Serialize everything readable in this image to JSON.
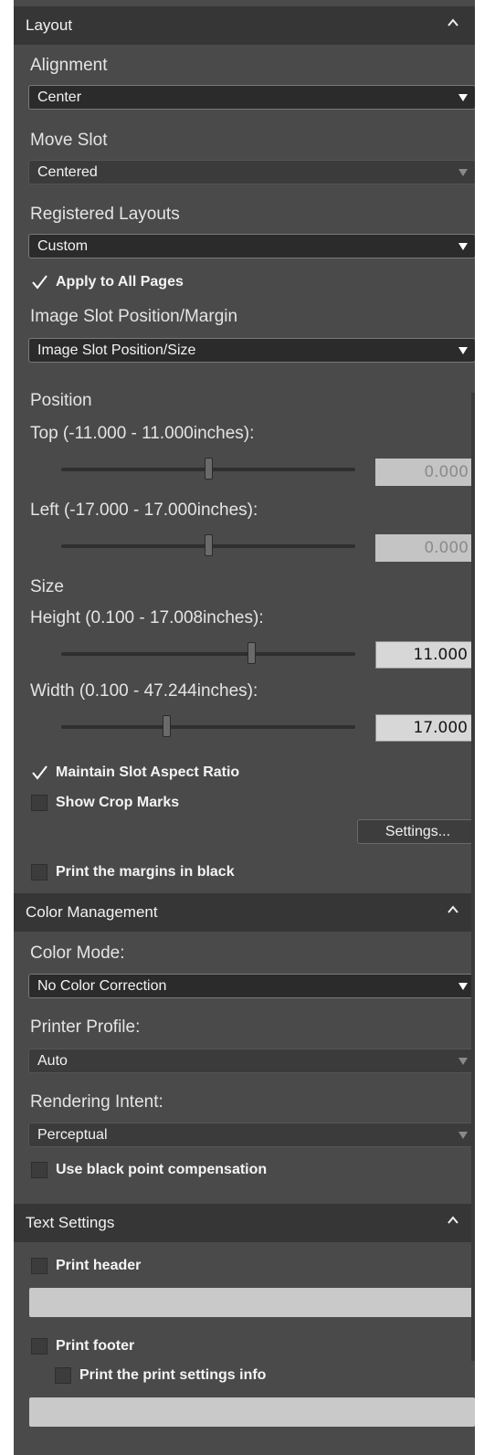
{
  "layout_section": {
    "title": "Layout",
    "alignment": {
      "label": "Alignment",
      "value": "Center"
    },
    "move_slot": {
      "label": "Move Slot",
      "value": "Centered"
    },
    "registered_layouts": {
      "label": "Registered Layouts",
      "value": "Custom"
    },
    "apply_all": {
      "label": "Apply to All Pages",
      "checked": true
    },
    "image_slot": {
      "label": "Image Slot Position/Margin",
      "value": "Image Slot Position/Size"
    },
    "position": {
      "label": "Position",
      "top": {
        "label": "Top (-11.000 - 11.000inches):",
        "value": "0.000",
        "slider_fraction": 0.5
      },
      "left": {
        "label": "Left (-17.000 - 17.000inches):",
        "value": "0.000",
        "slider_fraction": 0.5
      }
    },
    "size": {
      "label": "Size",
      "height": {
        "label": "Height (0.100 - 17.008inches):",
        "value": "11.000",
        "slider_fraction": 0.645
      },
      "width": {
        "label": "Width (0.100 - 47.244inches):",
        "value": "17.000",
        "slider_fraction": 0.358
      }
    },
    "maintain_aspect": {
      "label": "Maintain Slot Aspect Ratio",
      "checked": true
    },
    "crop_marks": {
      "label": "Show Crop Marks",
      "checked": false
    },
    "settings_button": "Settings...",
    "margins_black": {
      "label": "Print the margins in black",
      "checked": false
    }
  },
  "color_section": {
    "title": "Color Management",
    "color_mode": {
      "label": "Color Mode:",
      "value": "No Color Correction"
    },
    "printer_profile": {
      "label": "Printer Profile:",
      "value": "Auto"
    },
    "rendering_intent": {
      "label": "Rendering Intent:",
      "value": "Perceptual"
    },
    "black_point": {
      "label": "Use black point compensation",
      "checked": false
    }
  },
  "text_section": {
    "title": "Text Settings",
    "print_header": {
      "label": "Print header",
      "checked": false
    },
    "print_footer": {
      "label": "Print footer",
      "checked": false
    },
    "print_settings_info": {
      "label": "Print the print settings info",
      "checked": false
    }
  },
  "icons": {
    "collapse": "chevron-up-icon",
    "check": "checkmark-icon",
    "dropdown": "caret-down-icon"
  },
  "colors": {
    "panel_bg": "#4a4a4a",
    "header_bg": "#363636",
    "field_bg": "#2b2b2b"
  }
}
